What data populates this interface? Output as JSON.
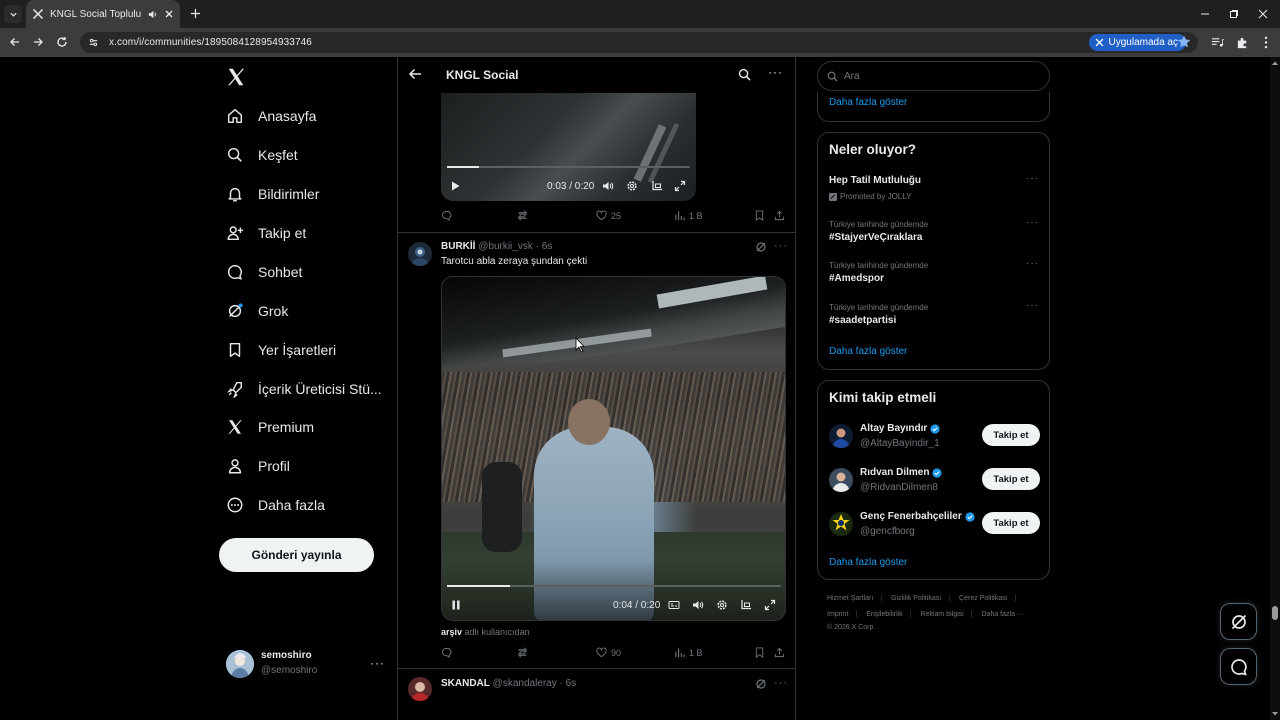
{
  "browser": {
    "tab_title": "KNGL Social Topluluk / X",
    "url": "x.com/i/communities/1895084128954933746",
    "open_in_app": "Uygulamada aç"
  },
  "nav": {
    "items": [
      {
        "label": "Anasayfa",
        "icon": "home-icon"
      },
      {
        "label": "Keşfet",
        "icon": "search-icon"
      },
      {
        "label": "Bildirimler",
        "icon": "bell-icon"
      },
      {
        "label": "Takip et",
        "icon": "person-add-icon"
      },
      {
        "label": "Sohbet",
        "icon": "chat-icon"
      },
      {
        "label": "Grok",
        "icon": "grok-icon"
      },
      {
        "label": "Yer İşaretleri",
        "icon": "bookmark-icon"
      },
      {
        "label": "İçerik Üreticisi Stü...",
        "icon": "rocket-icon"
      },
      {
        "label": "Premium",
        "icon": "x-icon"
      },
      {
        "label": "Profil",
        "icon": "person-icon"
      },
      {
        "label": "Daha fazla",
        "icon": "more-circle-icon"
      }
    ],
    "post_button": "Gönderi yayınla"
  },
  "account": {
    "name": "semoshiro",
    "handle": "@semoshiro"
  },
  "header": {
    "title": "KNGL Social"
  },
  "tweets": [
    {
      "video": {
        "time": "0:03 / 0:20",
        "progress": 0.13
      },
      "actions": {
        "likes": "25",
        "views": "1 B"
      }
    },
    {
      "name": "BURKİİ",
      "meta": "@burkii_vsk · 6s",
      "text": "Tarotcu abla zeraya şundan çekti",
      "video": {
        "time": "0:04 / 0:20",
        "progress": 0.19
      },
      "archive_user": "arşiv",
      "archive_suffix": " adlı kullanıcıdan",
      "actions": {
        "likes": "90",
        "views": "1 B"
      }
    },
    {
      "name": "SKANDAL",
      "meta": "@skandaleray · 6s"
    }
  ],
  "search": {
    "placeholder": "Ara"
  },
  "top_panel": {
    "show_more": "Daha fazla göster"
  },
  "trends": {
    "title": "Neler oluyor?",
    "items": [
      {
        "context": "Promoted by JOLLY",
        "name": "Hep Tatil Mutluluğu",
        "promoted": true
      },
      {
        "context": "Türkiye tarihinde gündemde",
        "name": "#StajyerVeÇıraklara"
      },
      {
        "context": "Türkiye tarihinde gündemde",
        "name": "#Amedspor"
      },
      {
        "context": "Türkiye tarihinde gündemde",
        "name": "#saadetpartisi"
      }
    ],
    "show_more": "Daha fazla göster"
  },
  "who_to_follow": {
    "title": "Kimi takip etmeli",
    "follow_label": "Takip et",
    "users": [
      {
        "name": "Altay Bayındır",
        "handle": "@AltayBayindir_1"
      },
      {
        "name": "Rıdvan Dilmen",
        "handle": "@RidvanDilmen8"
      },
      {
        "name": "Genç Fenerbahçeliler",
        "handle": "@gencfborg"
      }
    ],
    "show_more": "Daha fazla göster"
  },
  "footer": {
    "row1": [
      "Hizmet Şartları",
      "Gizlilik Politikası",
      "Çerez Politikası"
    ],
    "row2": [
      "Imprint",
      "Erişilebilirlik",
      "Reklam bilgisi",
      "Daha fazla ···"
    ],
    "copyright": "© 2026 X Corp."
  },
  "colors": {
    "accent": "#1d9bf0",
    "background": "#000000",
    "border": "#2f3336",
    "muted_text": "#71767b"
  }
}
